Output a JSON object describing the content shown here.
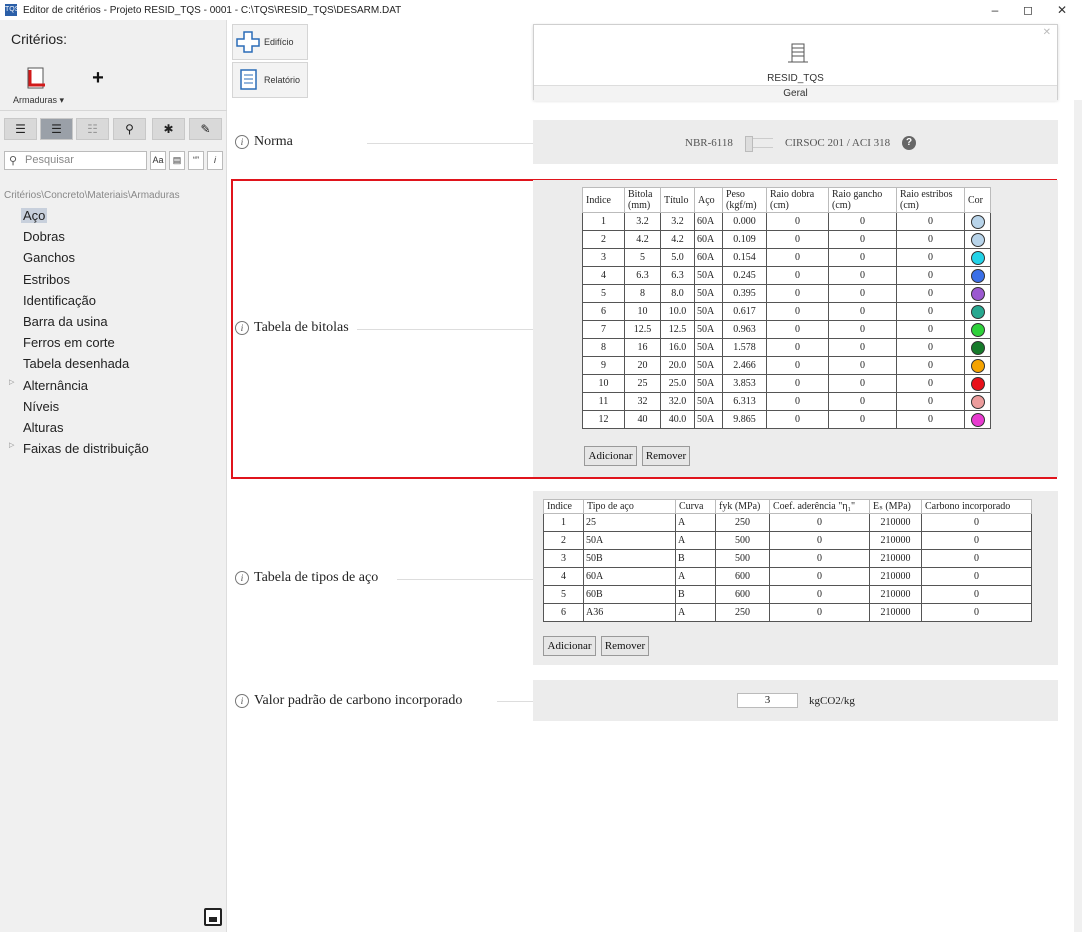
{
  "window": {
    "title": "Editor de critérios - Projeto RESID_TQS - 0001 - C:\\TQS\\RESID_TQS\\DESARM.DAT",
    "app_icon": "TQS"
  },
  "left": {
    "criterios_label": "Critérios:",
    "armaduras_label": "Armaduras",
    "search_placeholder": "Pesquisar",
    "search_opts": {
      "case": "Aa",
      "words": "“”",
      "info": "i"
    },
    "breadcrumb": "Critérios\\Concreto\\Materiais\\Armaduras",
    "tree": [
      {
        "label": "Aço",
        "selected": true
      },
      {
        "label": "Dobras"
      },
      {
        "label": "Ganchos"
      },
      {
        "label": "Estribos"
      },
      {
        "label": "Identificação"
      },
      {
        "label": "Barra da usina"
      },
      {
        "label": "Ferros em corte"
      },
      {
        "label": "Tabela desenhada"
      },
      {
        "label": "Alternância",
        "expandable": true
      },
      {
        "label": "Níveis"
      },
      {
        "label": "Alturas"
      },
      {
        "label": "Faixas de distribuição",
        "expandable": true
      }
    ]
  },
  "nav": {
    "edificio": "Edifício",
    "relatorio": "Relatório"
  },
  "card": {
    "name": "RESID_TQS",
    "tab": "Geral"
  },
  "norma": {
    "label": "Norma",
    "option_left": "NBR-6118",
    "option_right": "CIRSOC 201 / ACI 318"
  },
  "bitolas": {
    "label": "Tabela de bitolas",
    "headers": [
      "Indice",
      "Bitola (mm)",
      "Título",
      "Aço",
      "Peso (kgf/m)",
      "Raio dobra (cm)",
      "Raio gancho (cm)",
      "Raio estribos (cm)",
      "Cor"
    ],
    "rows": [
      [
        "1",
        "3.2",
        "3.2",
        "60A",
        "0.000",
        "0",
        "0",
        "0"
      ],
      [
        "2",
        "4.2",
        "4.2",
        "60A",
        "0.109",
        "0",
        "0",
        "0"
      ],
      [
        "3",
        "5",
        "5.0",
        "60A",
        "0.154",
        "0",
        "0",
        "0"
      ],
      [
        "4",
        "6.3",
        "6.3",
        "50A",
        "0.245",
        "0",
        "0",
        "0"
      ],
      [
        "5",
        "8",
        "8.0",
        "50A",
        "0.395",
        "0",
        "0",
        "0"
      ],
      [
        "6",
        "10",
        "10.0",
        "50A",
        "0.617",
        "0",
        "0",
        "0"
      ],
      [
        "7",
        "12.5",
        "12.5",
        "50A",
        "0.963",
        "0",
        "0",
        "0"
      ],
      [
        "8",
        "16",
        "16.0",
        "50A",
        "1.578",
        "0",
        "0",
        "0"
      ],
      [
        "9",
        "20",
        "20.0",
        "50A",
        "2.466",
        "0",
        "0",
        "0"
      ],
      [
        "10",
        "25",
        "25.0",
        "50A",
        "3.853",
        "0",
        "0",
        "0"
      ],
      [
        "11",
        "32",
        "32.0",
        "50A",
        "6.313",
        "0",
        "0",
        "0"
      ],
      [
        "12",
        "40",
        "40.0",
        "50A",
        "9.865",
        "0",
        "0",
        "0"
      ]
    ],
    "colors": [
      "#b8d4ea",
      "#b8d4ea",
      "#22d3e8",
      "#3a6fe8",
      "#9b59d0",
      "#27a890",
      "#2ed13a",
      "#157a2a",
      "#f5a300",
      "#e8101a",
      "#ec9c9c",
      "#e83ad0"
    ],
    "add": "Adicionar",
    "remove": "Remover"
  },
  "tipos": {
    "label": "Tabela de tipos de aço",
    "headers": [
      "Indice",
      "Tipo de aço",
      "Curva",
      "fyk (MPa)",
      "Coef. aderência \"η₁\"",
      "Eₛ (MPa)",
      "Carbono incorporado"
    ],
    "rows": [
      [
        "1",
        "25",
        "A",
        "250",
        "0",
        "210000",
        "0"
      ],
      [
        "2",
        "50A",
        "A",
        "500",
        "0",
        "210000",
        "0"
      ],
      [
        "3",
        "50B",
        "B",
        "500",
        "0",
        "210000",
        "0"
      ],
      [
        "4",
        "60A",
        "A",
        "600",
        "0",
        "210000",
        "0"
      ],
      [
        "5",
        "60B",
        "B",
        "600",
        "0",
        "210000",
        "0"
      ],
      [
        "6",
        "A36",
        "A",
        "250",
        "0",
        "210000",
        "0"
      ]
    ],
    "add": "Adicionar",
    "remove": "Remover"
  },
  "carbono": {
    "label": "Valor padrão de carbono incorporado",
    "value": "3",
    "unit": "kgCO2/kg"
  }
}
